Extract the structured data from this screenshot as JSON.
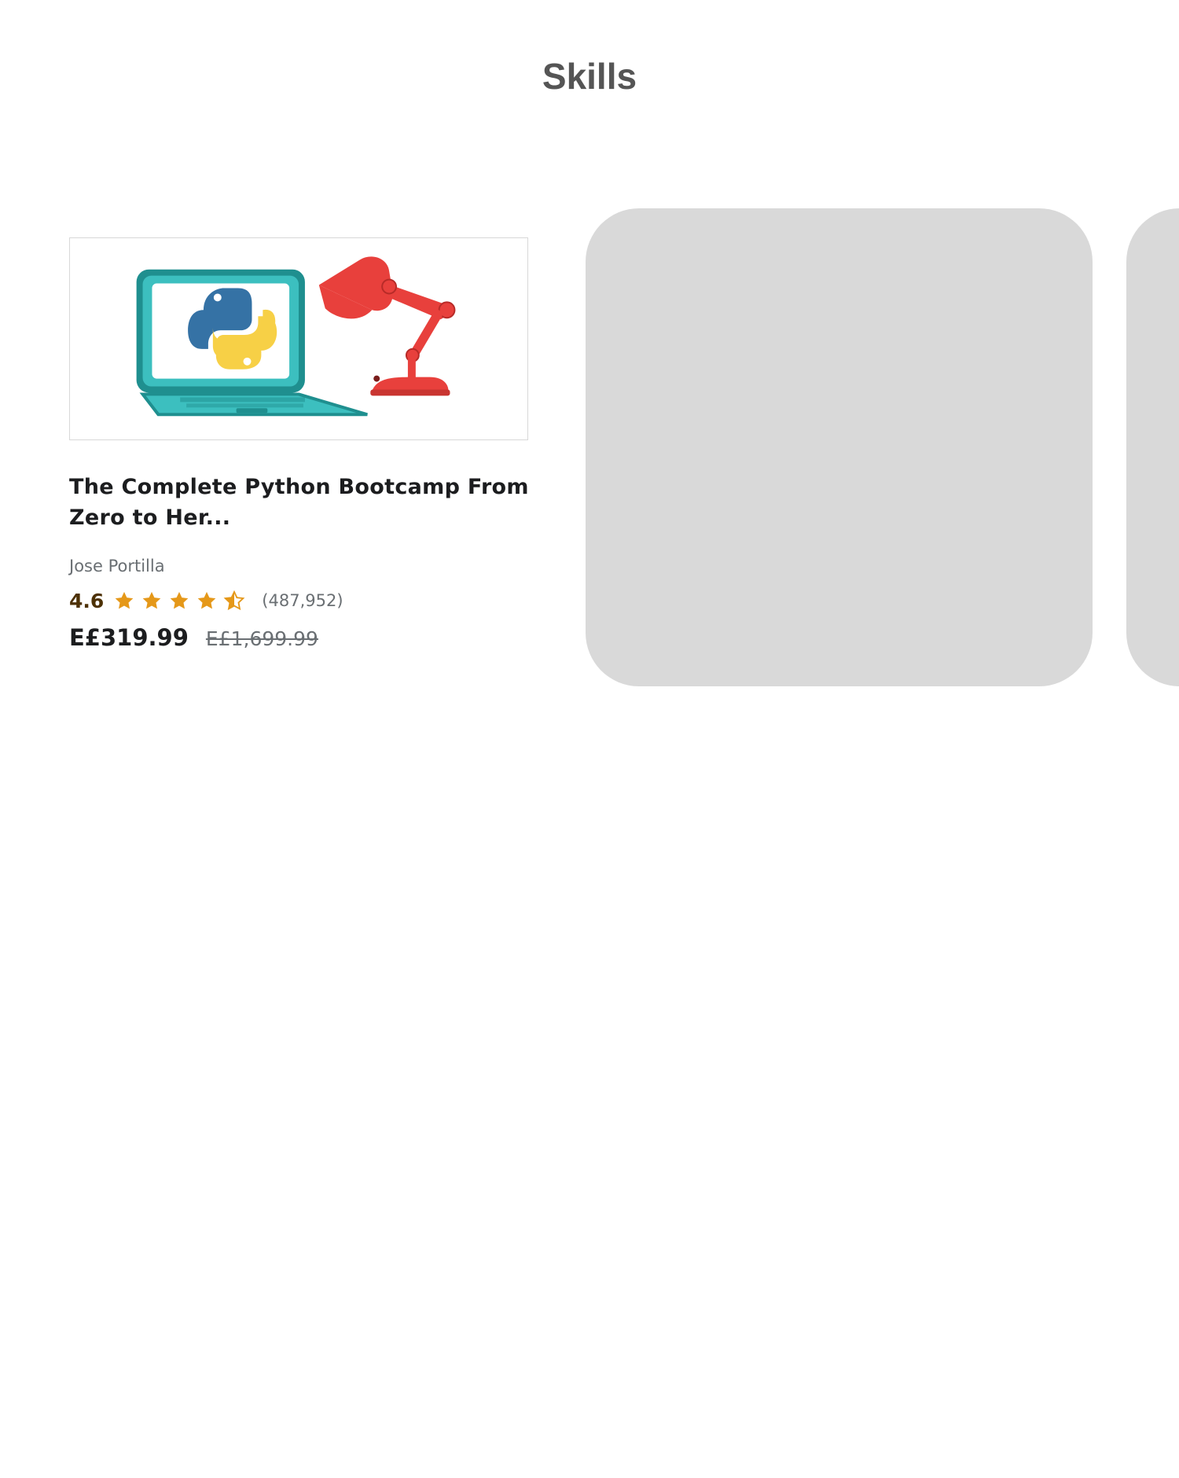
{
  "page": {
    "title": "Skills"
  },
  "course": {
    "title": "The Complete Python Bootcamp From Zero to Her...",
    "instructor": "Jose Portilla",
    "rating": "4.6",
    "rating_value": 4.6,
    "rating_max": 5,
    "reviews": "(487,952)",
    "price": "E£319.99",
    "original_price": "E£1,699.99",
    "thumbnail_icons": [
      "laptop-icon",
      "python-logo-icon",
      "desk-lamp-icon"
    ]
  },
  "colors": {
    "title_text": "#555555",
    "star": "#e59819",
    "rating_text": "#4d3105",
    "placeholder": "#d9d9d9",
    "laptop": "#3cbfbf",
    "lamp": "#e8403c",
    "python_blue": "#3572a5",
    "python_yellow": "#f7d046"
  }
}
